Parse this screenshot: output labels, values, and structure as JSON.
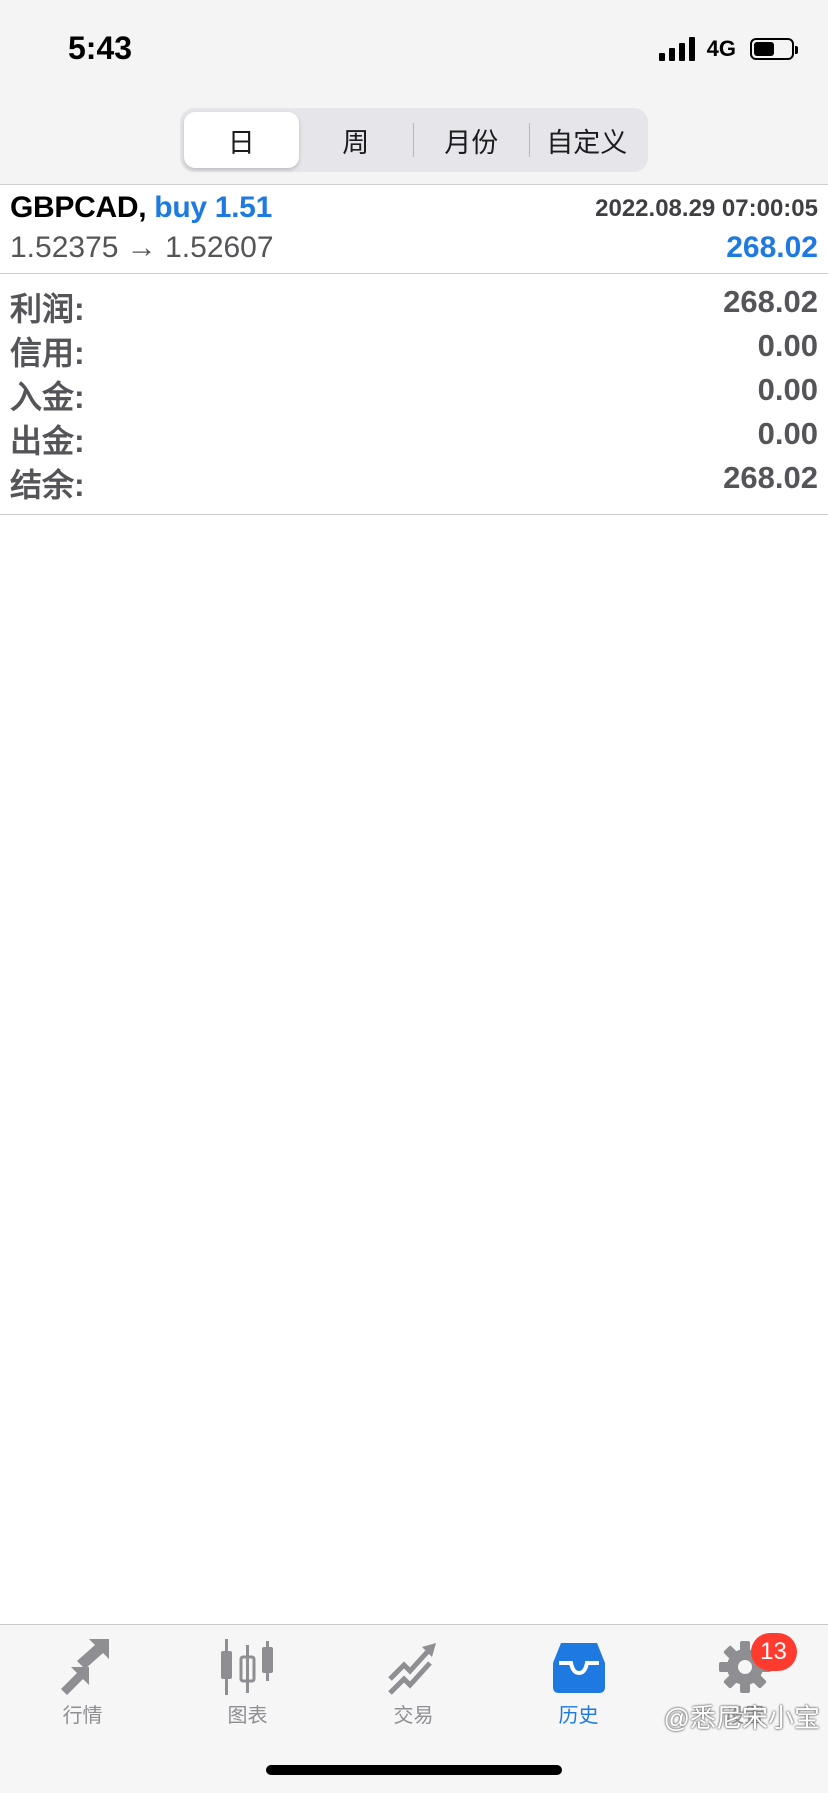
{
  "status_bar": {
    "time": "5:43",
    "network": "4G",
    "battery_level": 0.55
  },
  "period_tabs": [
    {
      "label": "日",
      "active": true
    },
    {
      "label": "周",
      "active": false
    },
    {
      "label": "月份",
      "active": false
    },
    {
      "label": "自定义",
      "active": false
    }
  ],
  "trade": {
    "symbol": "GBPCAD,",
    "side": "buy 1.51",
    "datetime": "2022.08.29 07:00:05",
    "prices": "1.52375 → 1.52607",
    "profit": "268.02"
  },
  "summary": [
    {
      "label": "利润:",
      "value": "268.02"
    },
    {
      "label": "信用:",
      "value": "0.00"
    },
    {
      "label": "入金:",
      "value": "0.00"
    },
    {
      "label": "出金:",
      "value": "0.00"
    },
    {
      "label": "结余:",
      "value": "268.02"
    }
  ],
  "tabbar": [
    {
      "label": "行情",
      "icon": "quotes-arrows-icon",
      "active": false
    },
    {
      "label": "图表",
      "icon": "candlestick-chart-icon",
      "active": false
    },
    {
      "label": "交易",
      "icon": "trade-chart-icon",
      "active": false
    },
    {
      "label": "历史",
      "icon": "history-inbox-icon",
      "active": true
    },
    {
      "label": "设置",
      "icon": "gear-icon",
      "active": false,
      "badge": "13"
    }
  ],
  "watermark": "@悉尼宋小宝",
  "colors": {
    "accent": "#1e7ae0",
    "badge": "#ff3b30",
    "text_gray": "#555559"
  }
}
